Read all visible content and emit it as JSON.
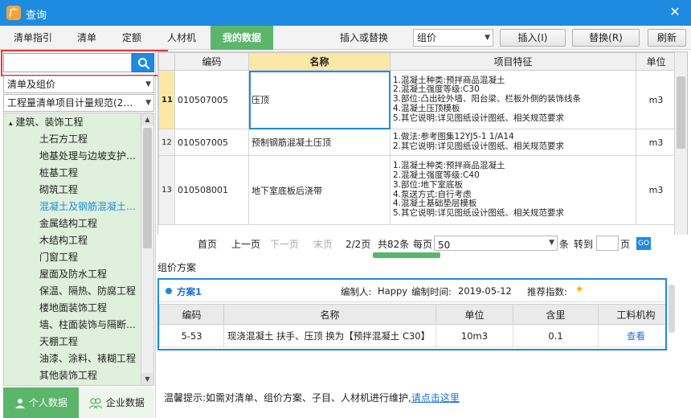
{
  "window": {
    "title": "查询",
    "close_glyph": "✕",
    "logo_glyph": "广"
  },
  "tabs": [
    {
      "label": "清单指引",
      "active": false
    },
    {
      "label": "清单",
      "active": false
    },
    {
      "label": "定额",
      "active": false
    },
    {
      "label": "人材机",
      "active": false
    },
    {
      "label": "我的数据",
      "active": true
    }
  ],
  "toolbar": {
    "insert_replace_label": "插入或替换",
    "mode_select": "组价",
    "extra_select": "",
    "insert_button": "插入(I)",
    "replace_button": "替换(R)",
    "refresh_button": "刷新"
  },
  "left": {
    "search": {
      "value": "",
      "placeholder": ""
    },
    "category_select": "清单及组价",
    "rule_select": "工程量清单项目计量规范(2…",
    "tree_root": {
      "toggle": "▴",
      "label": "建筑、装饰工程"
    },
    "tree_items": [
      {
        "label": "土石方工程"
      },
      {
        "label": "地基处理与边坡支护…"
      },
      {
        "label": "桩基工程"
      },
      {
        "label": "砌筑工程"
      },
      {
        "label": "混凝土及钢筋混凝土…",
        "selected": true
      },
      {
        "label": "金属结构工程"
      },
      {
        "label": "木结构工程"
      },
      {
        "label": "门窗工程"
      },
      {
        "label": "屋面及防水工程"
      },
      {
        "label": "保温、隔热、防腐工程"
      },
      {
        "label": "楼地面装饰工程"
      },
      {
        "label": "墙、柱面装饰与隔断…"
      },
      {
        "label": "天棚工程"
      },
      {
        "label": "油漆、涂料、裱糊工程"
      },
      {
        "label": "其他装饰工程"
      }
    ],
    "bottom_tabs": {
      "personal": "个人数据",
      "enterprise": "企业数据"
    }
  },
  "grid": {
    "headers": {
      "code": "编码",
      "name": "名称",
      "features": "项目特征",
      "unit": "单位"
    },
    "rows": [
      {
        "no": "11",
        "code": "010507005",
        "name": "压顶",
        "unit": "m3",
        "features": [
          "1.混凝土种类:预拌商品混凝土",
          "2.混凝土强度等级:C30",
          "3.部位:凸出砼外墙、阳台梁、栏板外侧的装饰线条",
          "4.混凝土压顶模板",
          "5.其它说明:详见图纸设计图纸、相关规范要求"
        ]
      },
      {
        "no": "12",
        "code": "010507005",
        "name": "预制钢筋混凝土压顶",
        "unit": "m3",
        "features": [
          "1.做法:参考图集12YJ5-1 1/A14",
          "2.其它说明:详见图纸设计图纸、相关规范要求"
        ]
      },
      {
        "no": "13",
        "code": "010508001",
        "name": "地下室底板后浇带",
        "unit": "m3",
        "features": [
          "1.混凝土种类:预拌商品混凝土",
          "2.混凝土强度等级:C40",
          "3.部位:地下室底板",
          "4.泵送方式:自行考虑",
          "4.混凝土基础垫层模板",
          "5.其它说明:详见图纸设计图纸、相关规范要求"
        ]
      }
    ]
  },
  "pager": {
    "first": "首页",
    "prev": "上一页",
    "next": "下一页",
    "last": "末页",
    "page": "2/2页",
    "total": "共82条",
    "per_page_label": "每页",
    "per_page": "50",
    "unit": "条",
    "goto_label": "转到",
    "goto_value": "",
    "page_unit": "页",
    "go": "GO"
  },
  "scheme_section": {
    "title": "组价方案",
    "scheme_name": "方案1",
    "author_label": "编制人:",
    "author": "Happy",
    "date_label": "编制时间:",
    "date": "2019-05-12",
    "rating_label": "推荐指数:",
    "star_glyph": "★",
    "headers": {
      "code": "编码",
      "name": "名称",
      "unit": "单位",
      "qty": "含里",
      "material": "工料机构"
    },
    "rows": [
      {
        "code": "5-53",
        "name": "现浇混凝土 扶手、压顶  换为【预拌混凝土 C30】",
        "unit": "10m3",
        "qty": "0.1",
        "action": "查看"
      }
    ]
  },
  "tip": {
    "text": "温馨提示:如需对清单、组价方案、子目、人材机进行维护,",
    "link": "请点击这里"
  },
  "colors": {
    "primary": "#1e8be0",
    "green": "#5bb56a",
    "highlight": "#fbe7a6",
    "red_frame": "#e23b3b"
  }
}
